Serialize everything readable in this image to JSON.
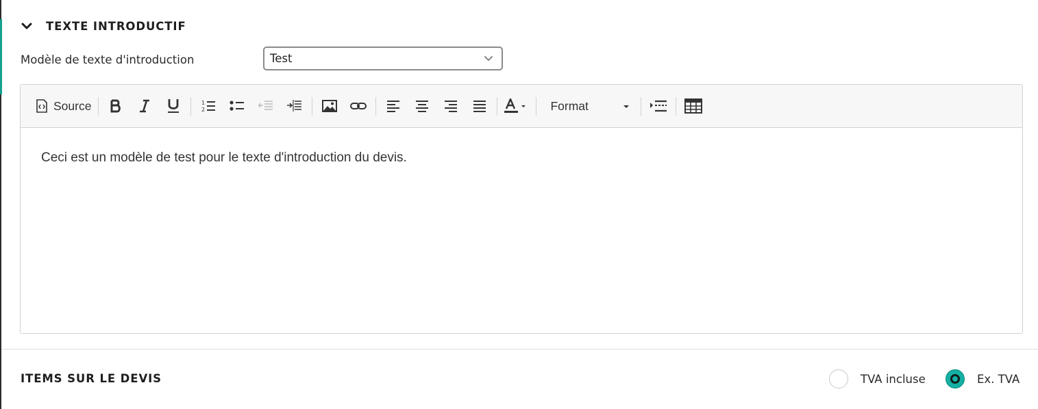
{
  "intro_section": {
    "title": "TEXTE INTRODUCTIF",
    "template_label": "Modèle de texte d'introduction",
    "template_select": {
      "selected": "Test"
    }
  },
  "editor": {
    "toolbar": {
      "source_label": "Source",
      "format_label": "Format"
    },
    "content": "Ceci est un modèle de test pour le texte d'introduction du devis."
  },
  "items_section": {
    "title": "ITEMS SUR LE DEVIS",
    "vat_options": [
      {
        "label": "TVA incluse",
        "checked": false
      },
      {
        "label": "Ex. TVA",
        "checked": true
      }
    ]
  },
  "colors": {
    "accent": "#14b0a3",
    "left_accent": "#14a08f"
  },
  "icons": [
    "chevron-down-icon",
    "source-icon",
    "bold-icon",
    "italic-icon",
    "underline-icon",
    "numbered-list-icon",
    "bulleted-list-icon",
    "outdent-icon",
    "indent-icon",
    "image-icon",
    "link-icon",
    "align-left-icon",
    "align-center-icon",
    "align-right-icon",
    "justify-icon",
    "text-color-icon",
    "format-dropdown-icon",
    "insert-placeholder-icon",
    "table-icon"
  ]
}
